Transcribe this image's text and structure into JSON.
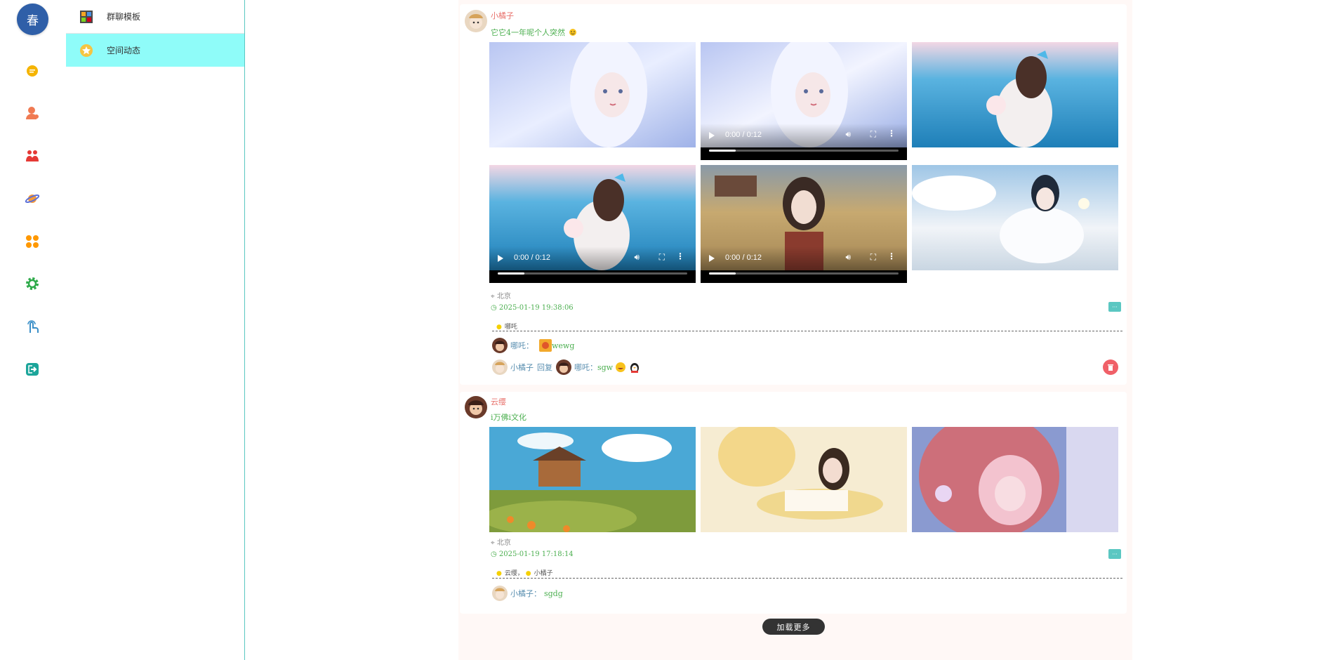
{
  "rail": {
    "avatar_text": "春",
    "items": [
      {
        "name": "chat-icon",
        "color": "#f5b400"
      },
      {
        "name": "contacts-icon",
        "color": "#f07a52"
      },
      {
        "name": "groups-icon",
        "color": "#e53935"
      },
      {
        "name": "planet-icon",
        "color": "#5b6fd8"
      },
      {
        "name": "apps-icon",
        "color": "#ff9800"
      },
      {
        "name": "settings-icon",
        "color": "#2eaa4a"
      },
      {
        "name": "touch-icon",
        "color": "#3a8fc8"
      },
      {
        "name": "logout-icon",
        "color": "#1ca59a"
      }
    ]
  },
  "sidebar": {
    "items": [
      {
        "label": "群聊模板",
        "active": false
      },
      {
        "label": "空间动态",
        "active": true
      }
    ]
  },
  "posts": [
    {
      "author": "小橘子",
      "text": "它它4一年呢个人突然",
      "location": "北京",
      "time": "2025-01-19 19:38:06",
      "likes": "哪吒",
      "media": [
        {
          "type": "image",
          "palette": [
            "#b9c6f2",
            "#e9eeff",
            "#9fb2e8"
          ]
        },
        {
          "type": "video",
          "time": "0:00 / 0:12",
          "palette": [
            "#b9c6f2",
            "#f2f4ff",
            "#9aaee6"
          ]
        },
        {
          "type": "image",
          "palette": [
            "#5ab3e0",
            "#f3d7e4",
            "#1e7fb8"
          ]
        },
        {
          "type": "video",
          "time": "0:00 / 0:12",
          "palette": [
            "#5ab3e0",
            "#f3d7e4",
            "#1e7fb8"
          ]
        },
        {
          "type": "video",
          "time": "0:00 / 0:12",
          "palette": [
            "#8a9aa8",
            "#c7a970",
            "#8a3b2e"
          ]
        },
        {
          "type": "image",
          "palette": [
            "#9fc6e6",
            "#f1f4f8",
            "#6d96bf"
          ]
        }
      ],
      "comments": [
        {
          "name": "哪吒：",
          "text": "wewg",
          "emoji": true
        },
        {
          "name": "小橘子",
          "reply_word": "回复",
          "target": "哪吒：",
          "text": "sgw"
        }
      ]
    },
    {
      "author": "云缨",
      "text": "i万佛i文化",
      "location": "北京",
      "time": "2025-01-19 17:18:14",
      "likes_list": [
        "云缨",
        "小橘子"
      ],
      "likes_sep": "，",
      "media": [
        {
          "type": "image",
          "palette": [
            "#4aa8d6",
            "#f0e4b0",
            "#5a8a3c"
          ]
        },
        {
          "type": "image",
          "palette": [
            "#f6ecd2",
            "#f3d78a",
            "#3a2a20"
          ]
        },
        {
          "type": "image",
          "palette": [
            "#cd6f7a",
            "#f3c3cf",
            "#8a9ad0"
          ]
        }
      ],
      "comments": [
        {
          "name": "小橘子：",
          "text": "sgdg"
        }
      ]
    }
  ],
  "load_more": "加载更多"
}
